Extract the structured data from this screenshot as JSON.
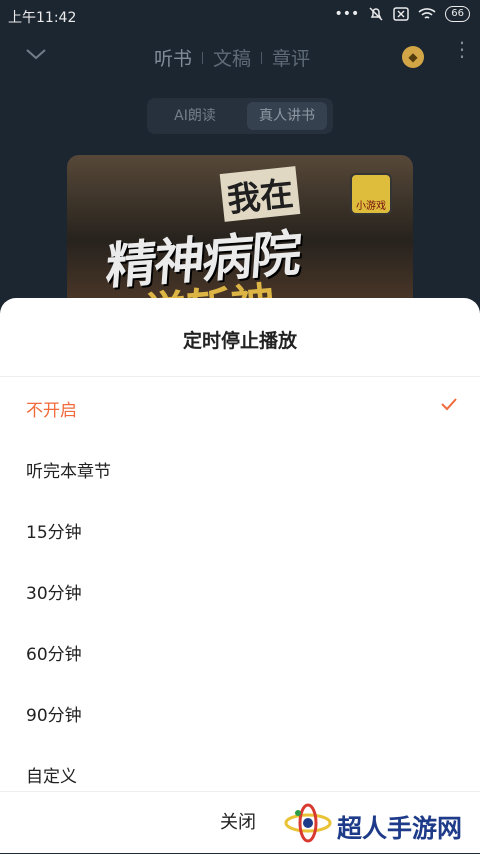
{
  "status_bar": {
    "time": "上午11:42",
    "battery": "66"
  },
  "header": {
    "tabs": [
      "听书",
      "文稿",
      "章评"
    ]
  },
  "mode_switch": {
    "ai": "AI朗读",
    "real": "真人讲书"
  },
  "cover": {
    "title_top": "我在",
    "title_main": "精神病院",
    "title_bottom": "学斩神",
    "badge": "小游戏"
  },
  "sheet": {
    "title": "定时停止播放",
    "options": [
      "不开启",
      "听完本章节",
      "15分钟",
      "30分钟",
      "60分钟",
      "90分钟",
      "自定义"
    ],
    "selected_index": 0,
    "close": "关闭"
  },
  "watermark": {
    "text": "超人手游网"
  },
  "colors": {
    "accent": "#f06a3b",
    "sheet_bg": "#ffffff",
    "dark_bg": "#1f2a36"
  }
}
